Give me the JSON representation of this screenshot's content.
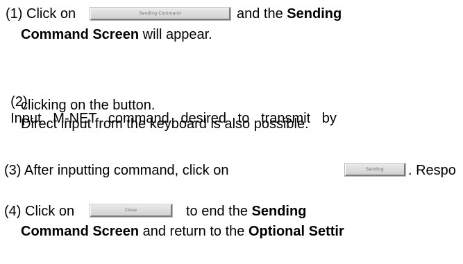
{
  "steps": [
    {
      "number": "(1)",
      "click_on": "Click on",
      "button_label": "Sending Command",
      "and_the": "and the",
      "bold_a": "Sending",
      "bold_b": "Command Screen",
      "rest": "will appear."
    },
    {
      "number": "(2)",
      "line1": "Input   M-NET   command   desired   to   transmit   by",
      "line2": "clicking on the button.",
      "line3": "Direct input from the keyboard is also possible."
    },
    {
      "number": "(3)",
      "text_before": "After inputting command, click on",
      "button_label": "Sending",
      "text_after": ". Respo"
    },
    {
      "number": "(4)",
      "click_on": "Click on",
      "button_label": "Close",
      "to_end": "to end the",
      "bold_a": "Sending",
      "bold_b": "Command Screen",
      "return_text": "and return to the",
      "bold_c": "Optional Settir"
    }
  ]
}
